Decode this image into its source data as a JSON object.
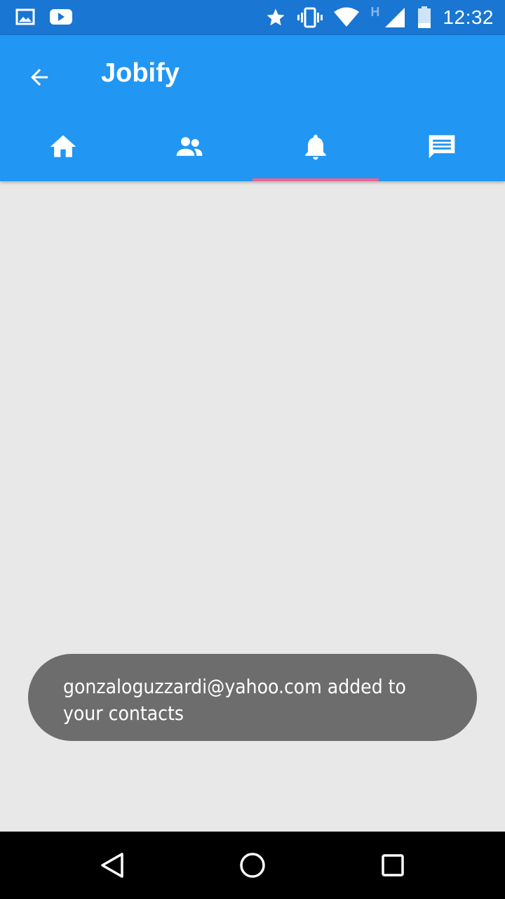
{
  "status_bar": {
    "time": "12:32",
    "network_type": "H",
    "icons": [
      "image-icon",
      "youtube-icon",
      "star-icon",
      "vibrate-icon",
      "wifi-icon",
      "signal-icon",
      "battery-icon"
    ]
  },
  "app_bar": {
    "title": "Jobify",
    "back_icon": "arrow-left-icon",
    "tabs": [
      {
        "icon": "home-icon",
        "selected": false
      },
      {
        "icon": "people-icon",
        "selected": false
      },
      {
        "icon": "bell-icon",
        "selected": true
      },
      {
        "icon": "message-icon",
        "selected": false
      }
    ],
    "colors": {
      "primary": "#2196f3",
      "status": "#1976d2",
      "indicator": "#f06292"
    }
  },
  "toast": {
    "message": "gonzaloguzzardi@yahoo.com added to your contacts"
  },
  "nav_bar": {
    "buttons": [
      "back-triangle-icon",
      "home-circle-icon",
      "recents-square-icon"
    ]
  }
}
